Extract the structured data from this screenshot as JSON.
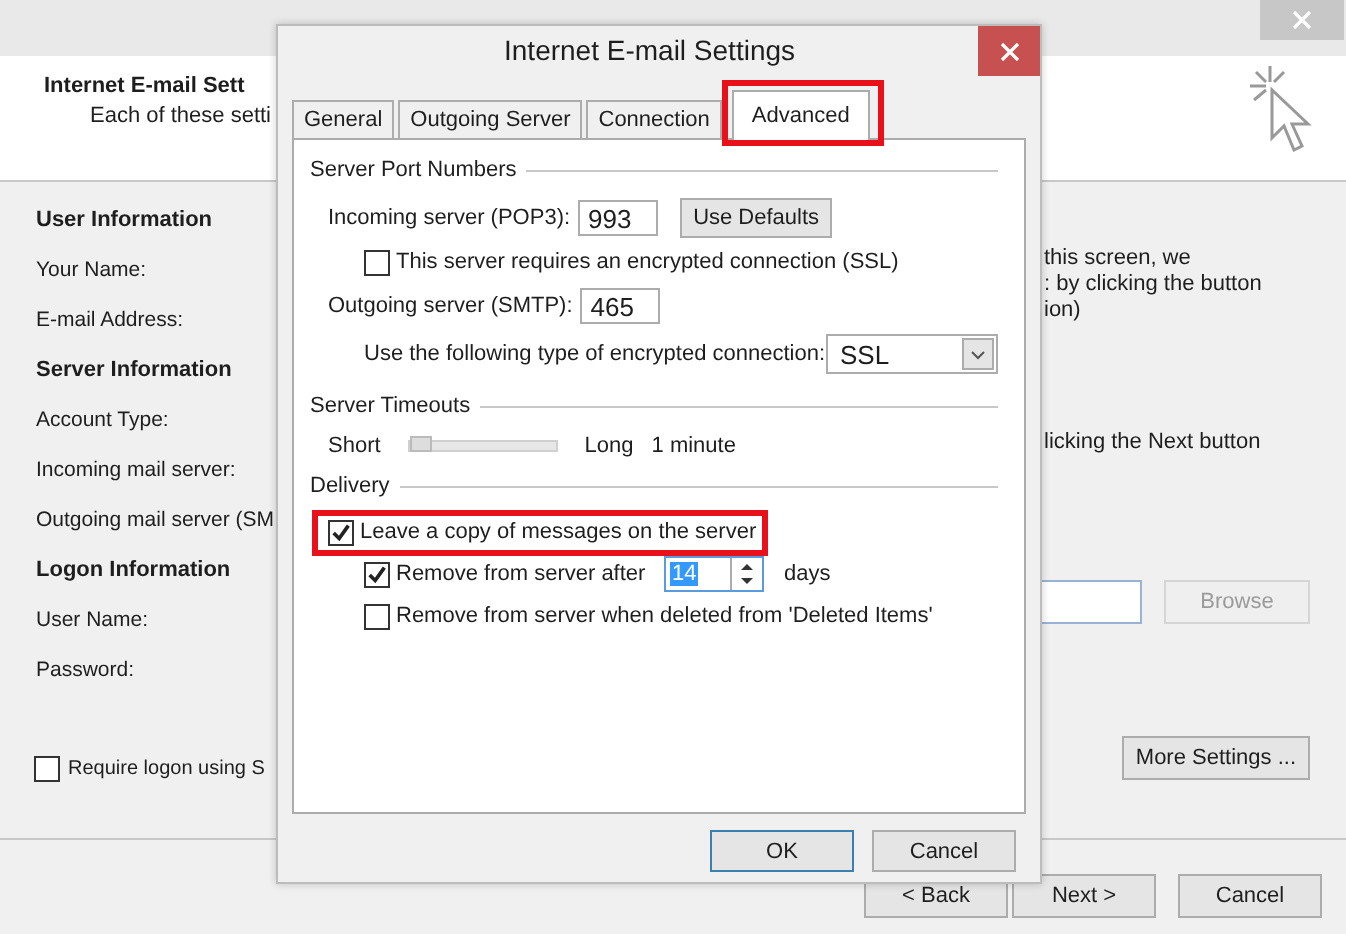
{
  "header": {
    "title": "Internet E-mail Sett",
    "subtitle": "Each of these setti"
  },
  "left": {
    "sections": [
      {
        "title": "User Information",
        "fields": [
          "Your Name:",
          "E-mail Address:"
        ]
      },
      {
        "title": "Server Information",
        "fields": [
          "Account Type:",
          "Incoming mail server:",
          "Outgoing mail server (SM"
        ]
      },
      {
        "title": "Logon Information",
        "fields": [
          "User Name:",
          "Password:"
        ]
      }
    ],
    "require_logon": {
      "label": "Require logon using S",
      "checked": false
    }
  },
  "right": {
    "notes": [
      "this screen, we",
      ": by clicking the button",
      "ion)"
    ],
    "note2": "licking the Next button",
    "browse": {
      "label": "Browse",
      "disabled": true
    },
    "more_settings": "More Settings ..."
  },
  "footer": {
    "buttons": [
      "< Back",
      "Next >",
      "Cancel"
    ]
  },
  "dialog": {
    "title": "Internet E-mail Settings",
    "tabs": [
      {
        "label": "General",
        "selected": false,
        "highlighted": false
      },
      {
        "label": "Outgoing Server",
        "selected": false,
        "highlighted": false
      },
      {
        "label": "Connection",
        "selected": false,
        "highlighted": false
      },
      {
        "label": "Advanced",
        "selected": true,
        "highlighted": true
      }
    ],
    "server_ports": {
      "heading": "Server Port Numbers",
      "incoming_label": "Incoming server (POP3):",
      "incoming_value": "993",
      "use_defaults": "Use Defaults",
      "ssl_required": {
        "label": "This server requires an encrypted connection (SSL)",
        "checked": false
      },
      "outgoing_label": "Outgoing server (SMTP):",
      "outgoing_value": "465",
      "encryption_label": "Use the following type of encrypted connection:",
      "encryption_value": "SSL"
    },
    "timeouts": {
      "heading": "Server Timeouts",
      "short": "Short",
      "long": "Long",
      "level": 0,
      "reading": "1 minute"
    },
    "delivery": {
      "heading": "Delivery",
      "leave_copy": {
        "label": "Leave a copy of messages on the server",
        "checked": true,
        "highlighted": true
      },
      "remove_after": {
        "label": "Remove from server after",
        "checked": true,
        "value": "14",
        "unit": "days"
      },
      "remove_deleted": {
        "label": "Remove from server when deleted from 'Deleted Items'",
        "checked": false
      }
    },
    "buttons": [
      {
        "label": "OK",
        "default": true
      },
      {
        "label": "Cancel",
        "default": false
      }
    ]
  }
}
